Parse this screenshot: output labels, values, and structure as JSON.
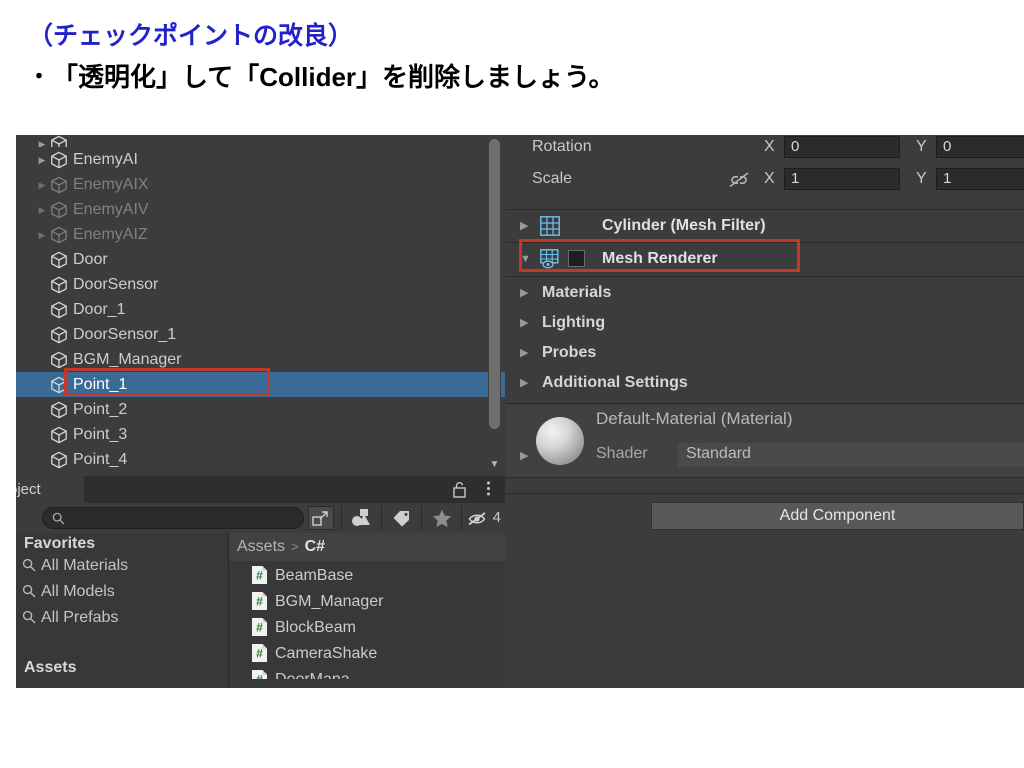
{
  "slide": {
    "title": "（チェックポイントの改良）",
    "bullet_marker": "・",
    "bullet_text": "「透明化」して「Collider」を削除しましょう。",
    "title_color": "#2222cc"
  },
  "hierarchy": {
    "items": [
      {
        "label": "",
        "clipped": true,
        "has_arrow": true,
        "faded": false,
        "selected": false
      },
      {
        "label": "EnemyAI",
        "clipped": false,
        "has_arrow": true,
        "faded": false,
        "selected": false
      },
      {
        "label": "EnemyAIX",
        "clipped": false,
        "has_arrow": true,
        "faded": true,
        "selected": false
      },
      {
        "label": "EnemyAIV",
        "clipped": false,
        "has_arrow": true,
        "faded": true,
        "selected": false
      },
      {
        "label": "EnemyAIZ",
        "clipped": false,
        "has_arrow": true,
        "faded": true,
        "selected": false
      },
      {
        "label": "Door",
        "clipped": false,
        "has_arrow": false,
        "faded": false,
        "selected": false
      },
      {
        "label": "DoorSensor",
        "clipped": false,
        "has_arrow": false,
        "faded": false,
        "selected": false
      },
      {
        "label": "Door_1",
        "clipped": false,
        "has_arrow": false,
        "faded": false,
        "selected": false
      },
      {
        "label": "DoorSensor_1",
        "clipped": false,
        "has_arrow": false,
        "faded": false,
        "selected": false
      },
      {
        "label": "BGM_Manager",
        "clipped": false,
        "has_arrow": false,
        "faded": false,
        "selected": false
      },
      {
        "label": "Point_1",
        "clipped": false,
        "has_arrow": false,
        "faded": false,
        "selected": true
      },
      {
        "label": "Point_2",
        "clipped": false,
        "has_arrow": false,
        "faded": false,
        "selected": false
      },
      {
        "label": "Point_3",
        "clipped": false,
        "has_arrow": false,
        "faded": false,
        "selected": false
      },
      {
        "label": "Point_4",
        "clipped": false,
        "has_arrow": false,
        "faded": false,
        "selected": false
      }
    ],
    "selection_color": "#3a6a96",
    "annotation_color": "#c0392b"
  },
  "project": {
    "tab_label": "roject",
    "lock_icon": "unlocked-padlock-icon",
    "menu_icon": "vertical-dots-icon",
    "search_placeholder": "",
    "search_value": "",
    "toolbar_icons": [
      "expand-icon",
      "shapes-filter-icon",
      "tag-icon",
      "star-icon",
      "hidden-eye-icon"
    ],
    "hidden_count": "4",
    "favorites_header": "Favorites",
    "favorites": [
      "All Materials",
      "All Models",
      "All Prefabs"
    ],
    "assets_header": "Assets",
    "breadcrumb": {
      "root": "Assets",
      "separator": ">",
      "current": "C#"
    },
    "assets": [
      {
        "label": "BeamBase",
        "clipped": false
      },
      {
        "label": "BGM_Manager",
        "clipped": false
      },
      {
        "label": "BlockBeam",
        "clipped": false
      },
      {
        "label": "CameraShake",
        "clipped": false
      },
      {
        "label": "DoorMana",
        "clipped": true
      }
    ]
  },
  "inspector": {
    "transform_rows": [
      {
        "label": "Rotation",
        "x_axis": "X",
        "x_value": "0",
        "y_axis": "Y",
        "y_value": "0",
        "has_link": false
      },
      {
        "label": "Scale",
        "x_axis": "X",
        "x_value": "1",
        "y_axis": "Y",
        "y_value": "1",
        "has_link": true
      }
    ],
    "link_icon": "linked-off-icon",
    "components": [
      {
        "title": "Cylinder (Mesh Filter)",
        "arrow": "▶",
        "icon": "mesh-filter-icon",
        "has_checkbox": false,
        "highlighted": false
      },
      {
        "title": "Mesh Renderer",
        "arrow": "▼",
        "icon": "mesh-renderer-icon",
        "has_checkbox": true,
        "checked": false,
        "highlighted": true
      }
    ],
    "sections": [
      "Materials",
      "Lighting",
      "Probes",
      "Additional Settings"
    ],
    "material": {
      "name": "Default-Material (Material)",
      "shader_label": "Shader",
      "shader_value": "Standard",
      "preview_icon": "material-sphere-preview"
    },
    "add_component_label": "Add Component"
  }
}
